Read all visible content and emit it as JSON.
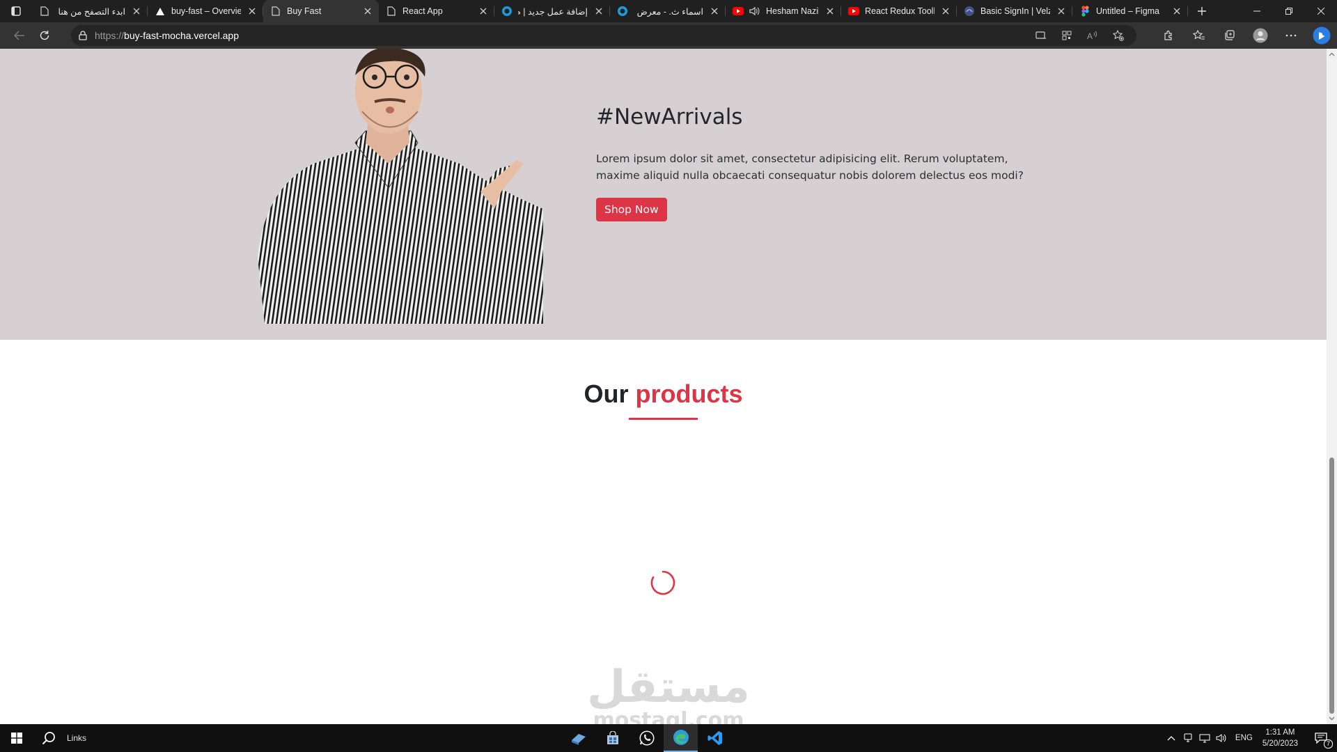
{
  "browser": {
    "tabs": [
      {
        "title": "ابدء التصفح من هنا",
        "rtl": true,
        "favicon": "page-icon",
        "active": false
      },
      {
        "title": "buy-fast – Overview",
        "rtl": false,
        "favicon": "vercel-icon",
        "active": false
      },
      {
        "title": "Buy Fast",
        "rtl": false,
        "favicon": "page-icon",
        "active": true
      },
      {
        "title": "React App",
        "rtl": false,
        "favicon": "page-icon",
        "active": false
      },
      {
        "title": "إضافة عمل جديد | م",
        "rtl": true,
        "favicon": "mostaql-icon",
        "active": false
      },
      {
        "title": "اسماء ث. - معرض ال",
        "rtl": true,
        "favicon": "mostaql-icon",
        "active": false
      },
      {
        "title": "Hesham Nazih",
        "rtl": false,
        "favicon": "youtube-icon",
        "active": false
      },
      {
        "title": "React Redux Toolkit",
        "rtl": false,
        "favicon": "youtube-icon",
        "active": false
      },
      {
        "title": "Basic SignIn | Velzon",
        "rtl": false,
        "favicon": "velzon-icon",
        "active": false
      },
      {
        "title": "Untitled – Figma",
        "rtl": false,
        "favicon": "figma-icon",
        "active": false
      }
    ],
    "url_scheme": "https://",
    "url_host": "buy-fast-mocha.vercel.app"
  },
  "hero": {
    "title": "#NewArrivals",
    "description": "Lorem ipsum dolor sit amet, consectetur adipisicing elit. Rerum voluptatem, maxime aliquid nulla obcaecati consequatur nobis dolorem delectus eos modi?",
    "cta_label": "Shop Now",
    "background": "#d6d0d3"
  },
  "products": {
    "heading_plain": "Our",
    "heading_accent": "products",
    "accent_color": "#dc3545",
    "loading": true
  },
  "watermark": {
    "brand_arabic": "مستقل",
    "brand_latin": "mostaql.com"
  },
  "taskbar": {
    "search_label": "Links",
    "apps": [
      "explorer-icon",
      "store-icon",
      "whatsapp-icon",
      "edge-icon",
      "vscode-icon"
    ],
    "language": "ENG",
    "time": "1:31 AM",
    "date": "5/20/2023",
    "notification_count": "7"
  }
}
